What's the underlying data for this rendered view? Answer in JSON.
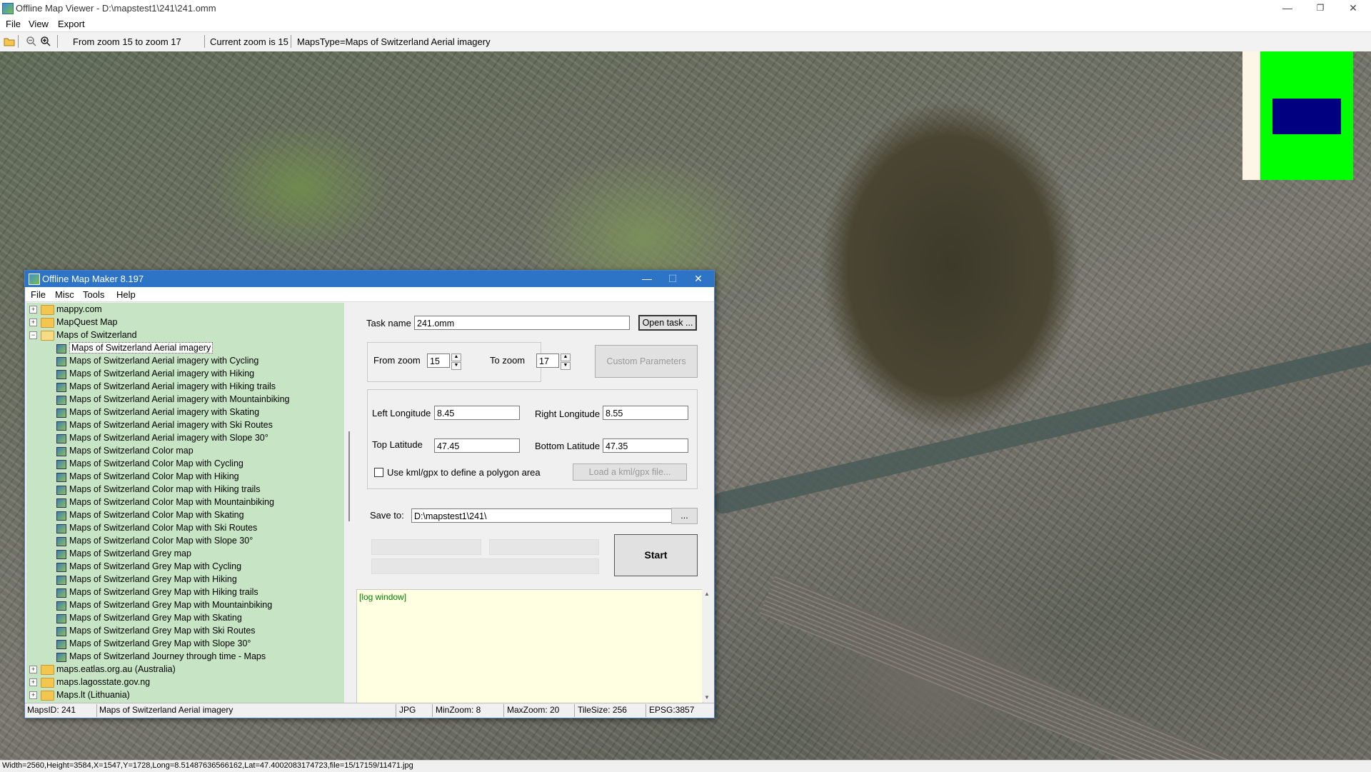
{
  "window": {
    "title": "Offline Map Viewer - D:\\mapstest1\\241\\241.omm",
    "minimize": "—",
    "maximize": "❐",
    "close": "✕"
  },
  "menu": [
    "File",
    "View",
    "Export"
  ],
  "toolbar": {
    "zoom_range": "From zoom 15 to zoom 17",
    "current_zoom": "Current zoom is 15",
    "maps_type": "MapsType=Maps of Switzerland Aerial imagery"
  },
  "minimap_colors": {
    "outer": "#fdf6e6",
    "green": "#00ff00",
    "viewport": "#000080"
  },
  "statusbar": "Width=2560,Height=3584,X=1547,Y=1728,Long=8.51487636566162,Lat=47.4002083174723,file=15/17159/11471.jpg",
  "dialog": {
    "title": "Offline Map Maker 8.197",
    "minimize": "—",
    "maximize": "☐",
    "close": "✕",
    "menu": [
      "File",
      "Misc",
      "Tools",
      "Help"
    ],
    "tree": {
      "top": [
        "mappy.com",
        "MapQuest Map"
      ],
      "group": "Maps of Switzerland",
      "items": [
        "Maps of Switzerland Aerial imagery",
        "Maps of Switzerland Aerial imagery with Cycling",
        "Maps of Switzerland Aerial imagery with Hiking",
        "Maps of Switzerland Aerial imagery with Hiking trails",
        "Maps of Switzerland Aerial imagery with Mountainbiking",
        "Maps of Switzerland Aerial imagery with Skating",
        "Maps of Switzerland Aerial imagery with Ski Routes",
        "Maps of Switzerland Aerial imagery with Slope 30°",
        "Maps of Switzerland Color map",
        "Maps of Switzerland Color Map with Cycling",
        "Maps of Switzerland Color Map with Hiking",
        "Maps of Switzerland Color map with Hiking trails",
        "Maps of Switzerland Color Map with Mountainbiking",
        "Maps of Switzerland Color Map with Skating",
        "Maps of Switzerland Color Map with Ski Routes",
        "Maps of Switzerland Color Map with Slope 30°",
        "Maps of Switzerland Grey map",
        "Maps of Switzerland Grey Map with Cycling",
        "Maps of Switzerland Grey Map with Hiking",
        "Maps of Switzerland Grey Map with Hiking trails",
        "Maps of Switzerland Grey Map with Mountainbiking",
        "Maps of Switzerland Grey Map with Skating",
        "Maps of Switzerland Grey Map with Ski Routes",
        "Maps of Switzerland Grey Map with Slope 30°",
        "Maps of Switzerland Journey through time - Maps"
      ],
      "bottom": [
        "maps.eatlas.org.au (Australia)",
        "maps.lagosstate.gov.ng",
        "Maps.lt (Lithuania)"
      ],
      "expander_plus": "+",
      "expander_minus": "−"
    },
    "task_name_label": "Task name",
    "task_name_value": "241.omm",
    "open_task": "Open task ...",
    "from_zoom_label": "From zoom",
    "from_zoom_value": "15",
    "to_zoom_label": "To zoom",
    "to_zoom_value": "17",
    "custom_params": "Custom Parameters",
    "left_lon_label": "Left Longitude",
    "left_lon_value": "8.45",
    "right_lon_label": "Right Longitude",
    "right_lon_value": "8.55",
    "top_lat_label": "Top Latitude",
    "top_lat_value": "47.45",
    "bottom_lat_label": "Bottom Latitude",
    "bottom_lat_value": "47.35",
    "kml_check_label": "Use kml/gpx to define a polygon area",
    "load_kml": "Load a kml/gpx file...",
    "save_to_label": "Save to:",
    "save_to_value": "D:\\mapstest1\\241\\",
    "browse": "...",
    "start": "Start",
    "log": "[log window]",
    "status": {
      "maps_id": "MapsID: 241",
      "maps_name": "Maps of Switzerland Aerial imagery",
      "format": "JPG",
      "min_zoom": "MinZoom: 8",
      "max_zoom": "MaxZoom: 20",
      "tile_size": "TileSize: 256",
      "epsg": "EPSG:3857"
    }
  }
}
